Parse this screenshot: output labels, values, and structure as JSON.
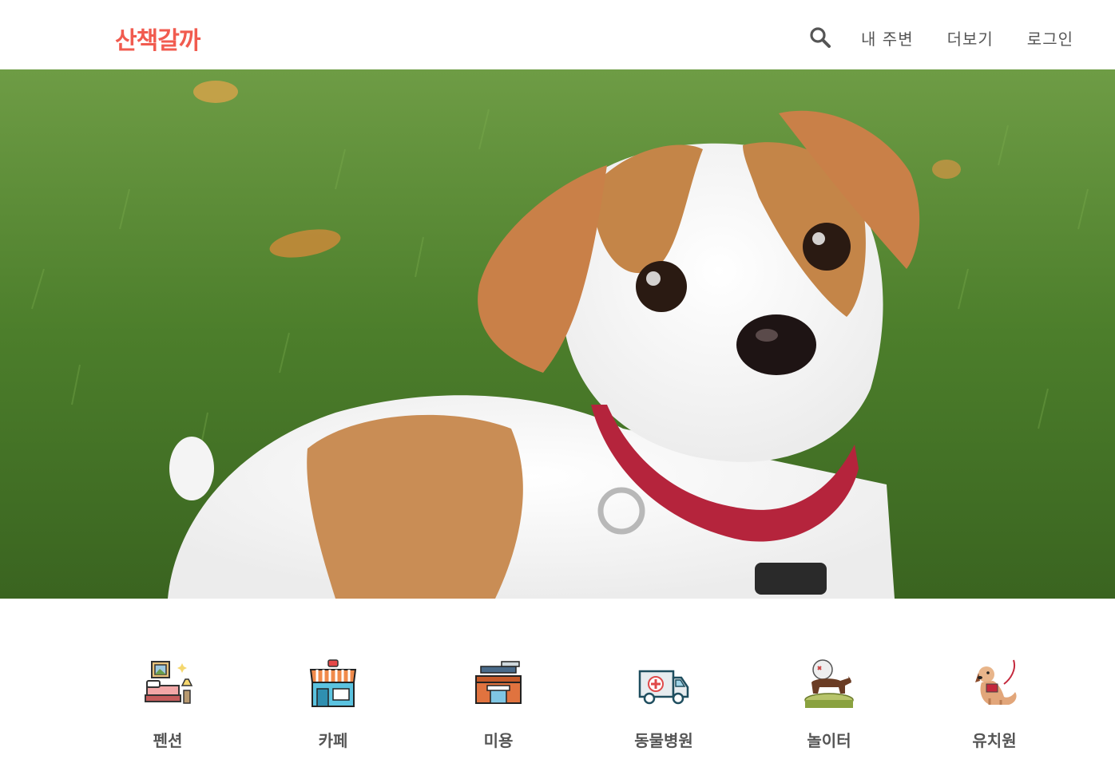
{
  "header": {
    "logo": "산책갈까",
    "search_icon": "search-icon",
    "nav": [
      {
        "label": "내 주변"
      },
      {
        "label": "더보기"
      },
      {
        "label": "로그인"
      }
    ]
  },
  "hero": {
    "image": "puppy-on-grass-photo"
  },
  "categories": [
    {
      "label": "펜션",
      "icon": "pension-bed-icon"
    },
    {
      "label": "카페",
      "icon": "cafe-shop-icon"
    },
    {
      "label": "미용",
      "icon": "grooming-shop-icon"
    },
    {
      "label": "동물병원",
      "icon": "ambulance-icon"
    },
    {
      "label": "놀이터",
      "icon": "playground-dog-icon"
    },
    {
      "label": "유치원",
      "icon": "kindergarten-dog-icon"
    }
  ],
  "colors": {
    "brand": "#f15b4f",
    "nav_text": "#555555",
    "label_text": "#555555"
  }
}
